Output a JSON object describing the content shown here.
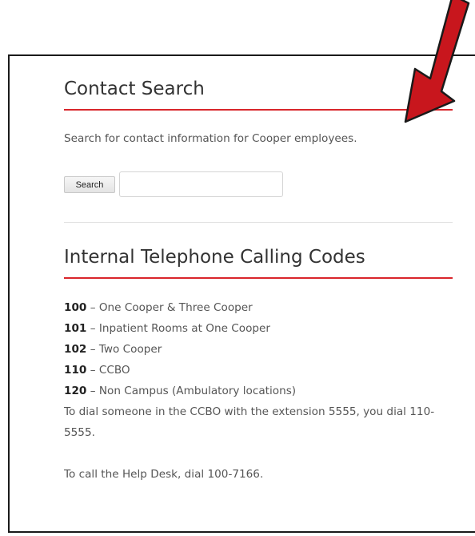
{
  "contact_search": {
    "title": "Contact Search",
    "description": "Search for contact information for Cooper employees.",
    "search_button_label": "Search",
    "search_input_value": ""
  },
  "calling_codes": {
    "title": "Internal Telephone Calling Codes",
    "items": [
      {
        "code": "100",
        "separator": " – ",
        "label": "One Cooper & Three Cooper"
      },
      {
        "code": "101",
        "separator": " – ",
        "label": "Inpatient Rooms at One Cooper"
      },
      {
        "code": "102",
        "separator": " – ",
        "label": "Two Cooper"
      },
      {
        "code": "110",
        "separator": " – ",
        "label": "CCBO"
      },
      {
        "code": "120",
        "separator": " – ",
        "label": "Non Campus (Ambulatory locations)"
      }
    ],
    "dial_note": "To dial someone in the CCBO with the extension 5555, you dial 110-5555.",
    "help_note": "To call the Help Desk, dial 100-7166."
  },
  "colors": {
    "accent_rule": "#d9262c",
    "arrow_fill": "#c8161d",
    "arrow_outline": "#1a1a1a"
  },
  "annotation": {
    "icon": "red-arrow-icon"
  }
}
